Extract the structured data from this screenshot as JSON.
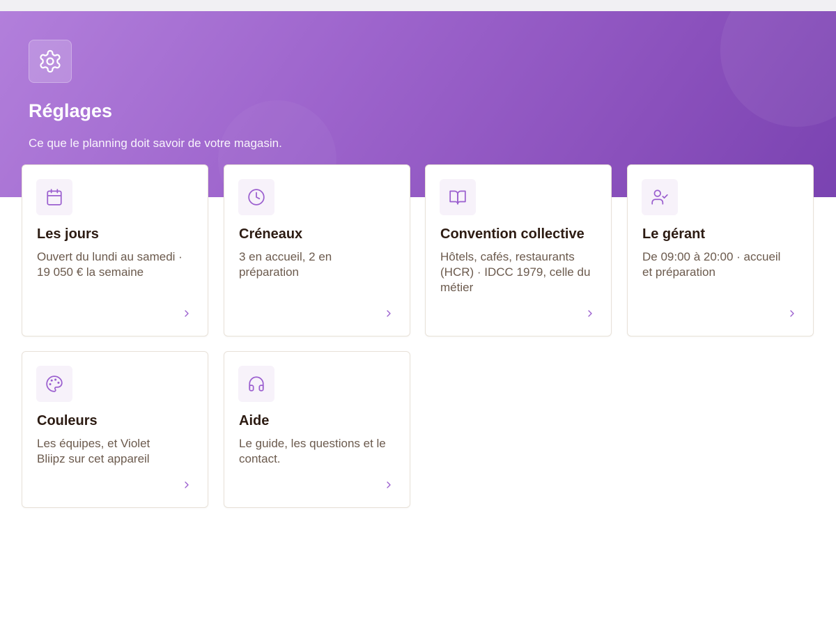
{
  "header": {
    "title": "Réglages",
    "subtitle": "Ce que le planning doit savoir de votre magasin.",
    "icon": "gear-icon"
  },
  "cards": [
    {
      "title": "Les jours",
      "description": "Ouvert du lundi au samedi · 19 050 € la semaine",
      "icon": "calendar-icon"
    },
    {
      "title": "Créneaux",
      "description": "3 en accueil, 2 en préparation",
      "icon": "clock-icon"
    },
    {
      "title": "Convention collective",
      "description": "Hôtels, cafés, restaurants (HCR) · IDCC 1979, celle du métier",
      "icon": "book-icon"
    },
    {
      "title": "Le gérant",
      "description": "De 09:00 à 20:00 · accueil et préparation",
      "icon": "user-check-icon"
    },
    {
      "title": "Couleurs",
      "description": "Les équipes, et Violet Bliipz sur cet appareil",
      "icon": "palette-icon"
    },
    {
      "title": "Aide",
      "description": "Le guide, les questions et le contact.",
      "icon": "headphones-icon"
    }
  ],
  "colors": {
    "accent": "#9b5fcf",
    "title_text": "#2c1b12",
    "body_text": "#6b5a4d"
  }
}
